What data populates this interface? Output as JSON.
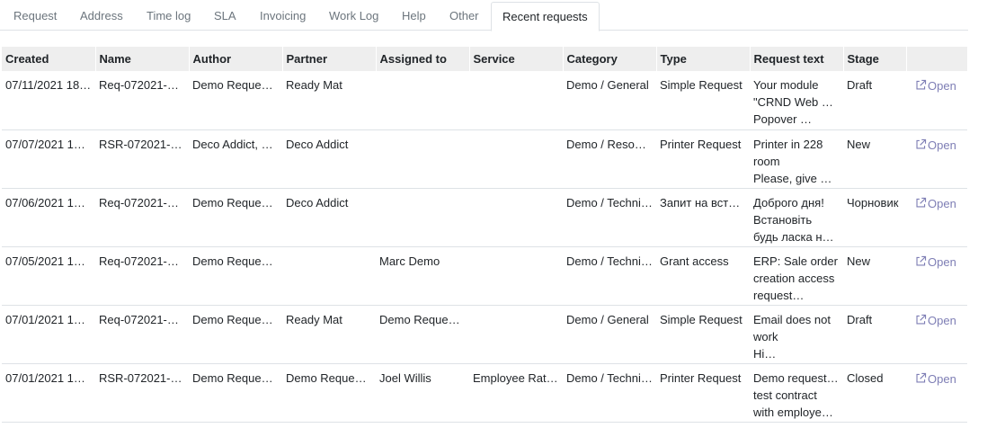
{
  "tabs": [
    {
      "label": "Request"
    },
    {
      "label": "Address"
    },
    {
      "label": "Time log"
    },
    {
      "label": "SLA"
    },
    {
      "label": "Invoicing"
    },
    {
      "label": "Work Log"
    },
    {
      "label": "Help"
    },
    {
      "label": "Other"
    },
    {
      "label": "Recent requests",
      "active": true
    }
  ],
  "table": {
    "columns": [
      "Created",
      "Name",
      "Author",
      "Partner",
      "Assigned to",
      "Service",
      "Category",
      "Type",
      "Request text",
      "Stage",
      ""
    ],
    "open_label": "Open",
    "rows": [
      {
        "created": "07/11/2021 18…",
        "name": "Req-072021-0…",
        "author": "Demo Reques…",
        "partner": "Ready Mat",
        "assigned": "",
        "service": "",
        "category": "Demo / General",
        "type": "Simple Request",
        "text": [
          "Your module",
          "\"CRND Web List",
          "Popover …"
        ],
        "stage": "Draft"
      },
      {
        "created": "07/07/2021 18…",
        "name": "RSR-072021-…",
        "author": "Deco Addict, …",
        "partner": "Deco Addict",
        "assigned": "",
        "service": "",
        "category": "Demo / Resou…",
        "type": "Printer Request",
        "text": [
          "Printer in 228",
          "room",
          "Please, give …"
        ],
        "stage": "New"
      },
      {
        "created": "07/06/2021 18…",
        "name": "Req-072021-0…",
        "author": "Demo Reques…",
        "partner": "Deco Addict",
        "assigned": "",
        "service": "",
        "category": "Demo / Techni…",
        "type": "Запит на вст…",
        "text": [
          "Доброго дня!",
          "Встановіть",
          "будь ласка н…"
        ],
        "stage": "Чорновик"
      },
      {
        "created": "07/05/2021 18…",
        "name": "Req-072021-0…",
        "author": "Demo Reques…",
        "partner": "",
        "assigned": "Marc Demo",
        "service": "",
        "category": "Demo / Techni…",
        "type": "Grant access",
        "text": [
          "ERP: Sale order",
          "creation access",
          "request…"
        ],
        "stage": "New"
      },
      {
        "created": "07/01/2021 19…",
        "name": "Req-072021-0…",
        "author": "Demo Reques…",
        "partner": "Ready Mat",
        "assigned": "Demo Reques…",
        "service": "",
        "category": "Demo / General",
        "type": "Simple Request",
        "text": [
          "Email does not",
          "work",
          "Hi…"
        ],
        "stage": "Draft"
      },
      {
        "created": "07/01/2021 19…",
        "name": "RSR-072021-…",
        "author": "Demo Reques…",
        "partner": "Demo Reques…",
        "assigned": "Joel Willis",
        "service": "Employee Rat…",
        "category": "Demo / Techni…",
        "type": "Printer Request",
        "text": [
          "Demo request to",
          "test contract",
          "with employee…"
        ],
        "stage": "Closed"
      }
    ]
  }
}
